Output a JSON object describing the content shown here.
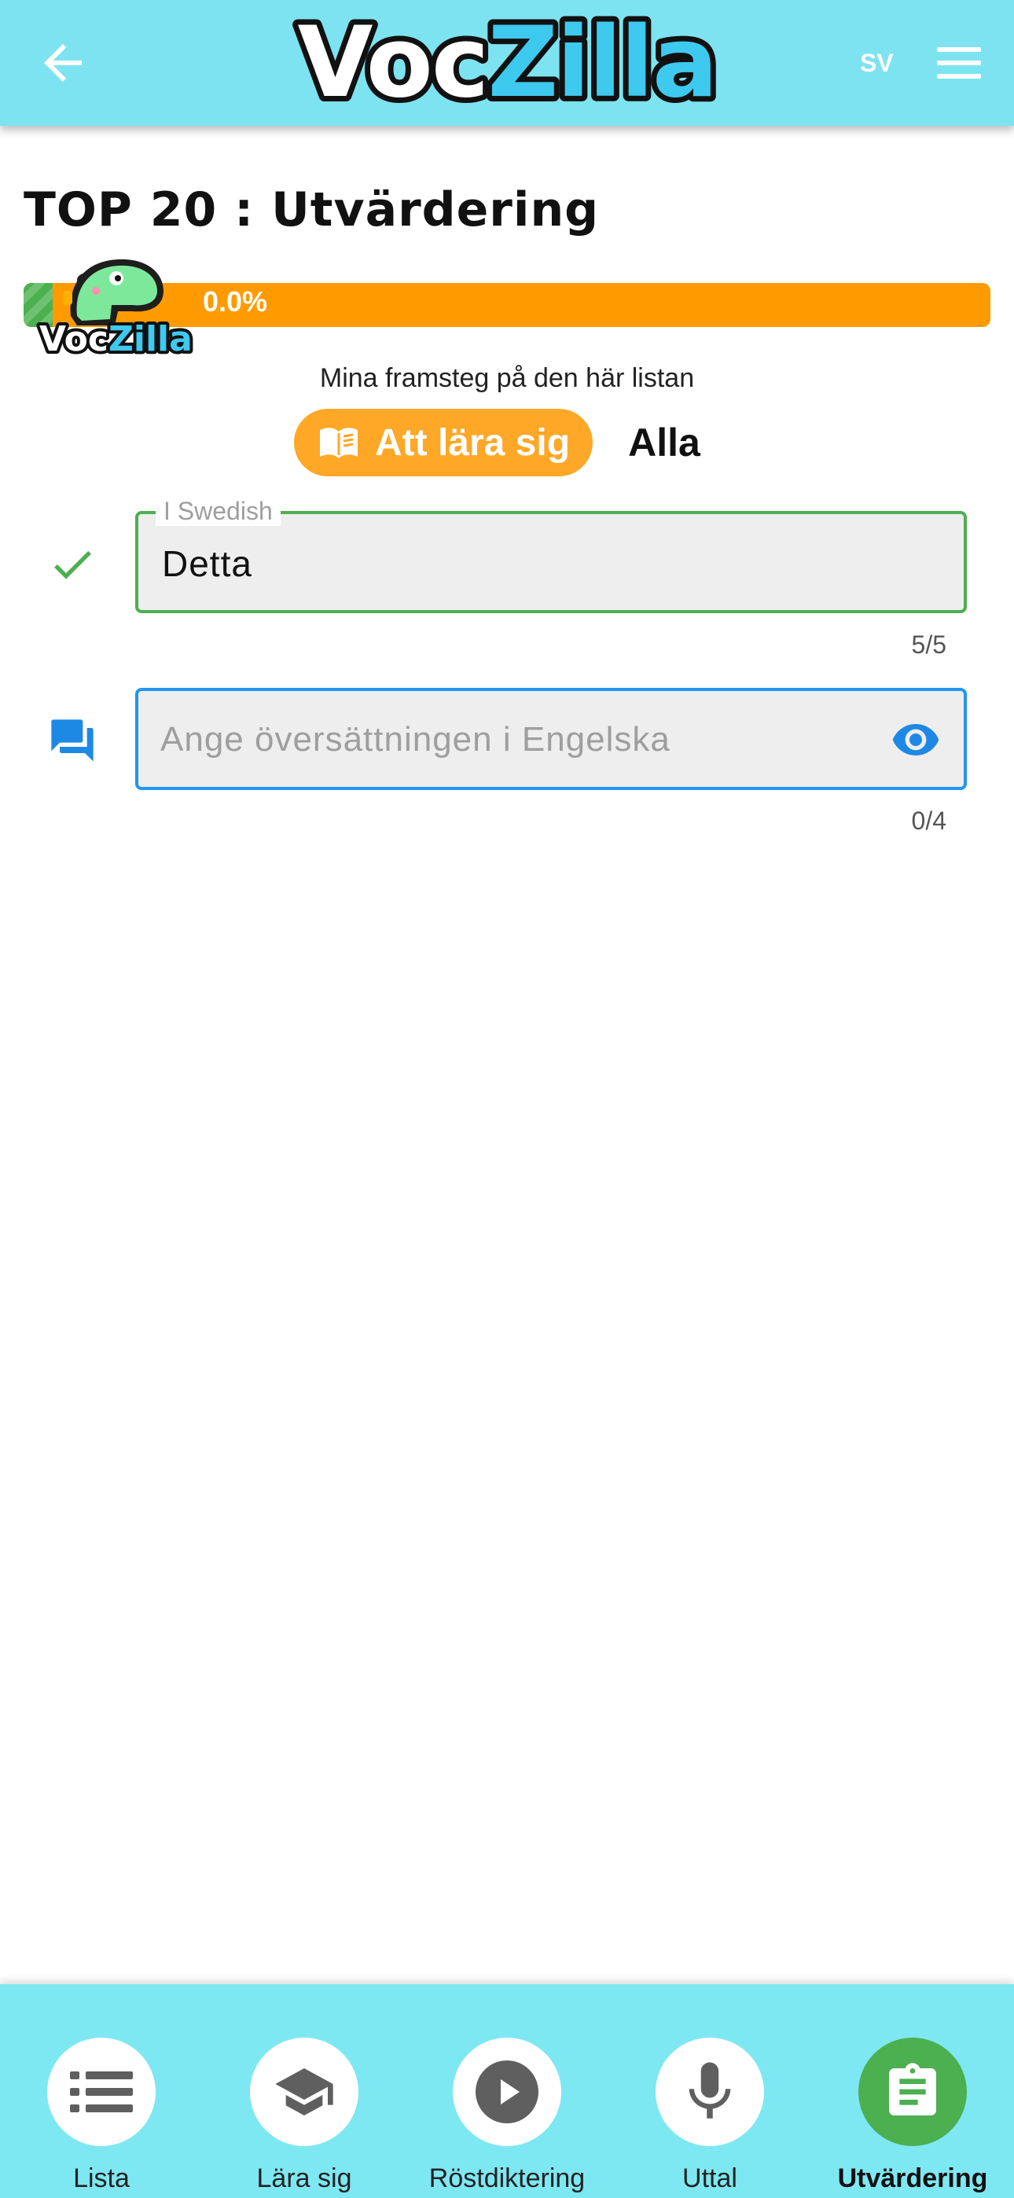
{
  "header": {
    "back_icon": "arrow-left-icon",
    "logo_part1": "Voc",
    "logo_part2": "Zilla",
    "language": "SV",
    "menu_icon": "hamburger-icon"
  },
  "page": {
    "title": "TOP 20 : Utvärdering"
  },
  "progress": {
    "fraction": 0.03,
    "text": "0.0%",
    "caption": "Mina framsteg på den här listan",
    "mascot_text_1": "Voc",
    "mascot_text_2": "Zilla"
  },
  "filters": {
    "learn_label": "Att lära sig",
    "learn_icon": "book-icon",
    "all_label": "Alla"
  },
  "source_field": {
    "label": "I Swedish",
    "value": "Detta",
    "counter": "5/5",
    "status_icon": "checkmark-icon"
  },
  "answer_field": {
    "placeholder": "Ange översättningen i Engelska",
    "value": "",
    "counter": "0/4",
    "row_icon": "chat-bubbles-icon",
    "reveal_icon": "eye-icon"
  },
  "nav": {
    "items": [
      {
        "label": "Lista",
        "icon": "list-icon"
      },
      {
        "label": "Lära sig",
        "icon": "graduation-cap-icon"
      },
      {
        "label": "Röstdiktering",
        "icon": "play-icon"
      },
      {
        "label": "Uttal",
        "icon": "microphone-icon"
      },
      {
        "label": "Utvärdering",
        "icon": "clipboard-icon",
        "active": true
      }
    ]
  },
  "colors": {
    "header_bg": "#7de3f0",
    "accent_orange": "#ff9b00",
    "success_green": "#4caf50",
    "focus_blue": "#2196f3"
  }
}
